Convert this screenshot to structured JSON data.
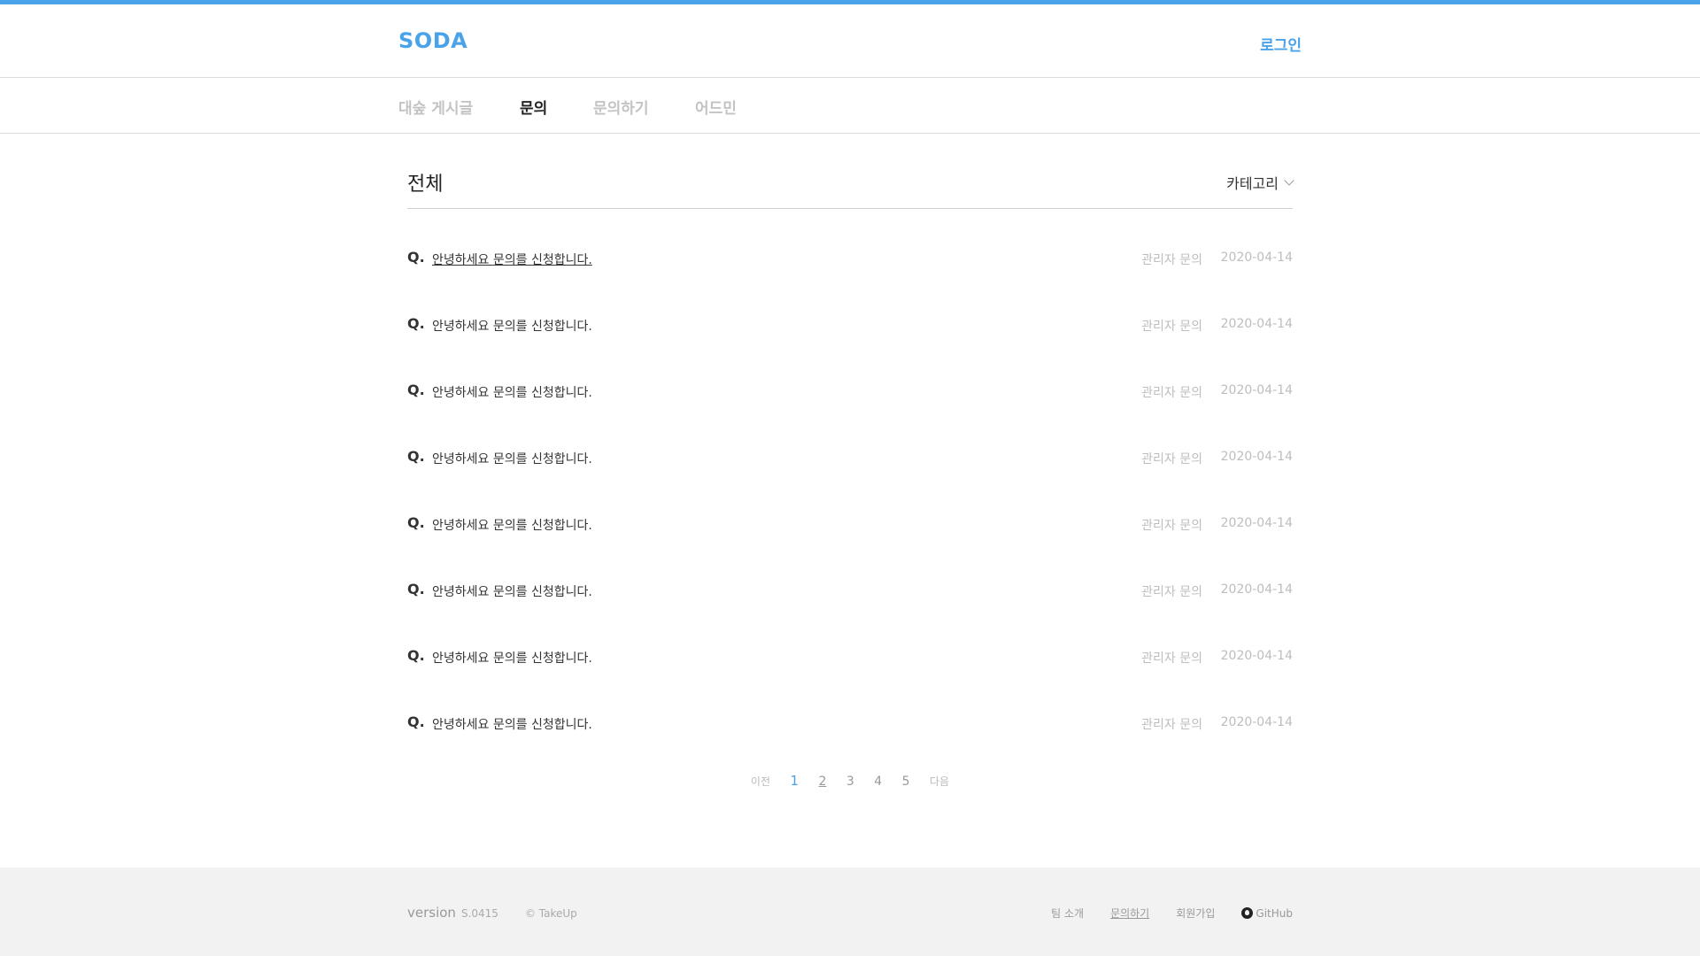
{
  "header": {
    "logo": "SODA",
    "login_label": "로그인"
  },
  "nav": {
    "items": [
      {
        "label": "대숲 게시글",
        "active": false
      },
      {
        "label": "문의",
        "active": true
      },
      {
        "label": "문의하기",
        "active": false
      },
      {
        "label": "어드민",
        "active": false
      }
    ]
  },
  "board": {
    "title": "전체",
    "category_label": "카테고리"
  },
  "list": {
    "q_mark": "Q.",
    "rows": [
      {
        "title": "안녕하세요 문의를 신청합니다.",
        "author": "관리자 문의",
        "date": "2020-04-14"
      },
      {
        "title": "안녕하세요 문의를 신청합니다.",
        "author": "관리자 문의",
        "date": "2020-04-14"
      },
      {
        "title": "안녕하세요 문의를 신청합니다.",
        "author": "관리자 문의",
        "date": "2020-04-14"
      },
      {
        "title": "안녕하세요 문의를 신청합니다.",
        "author": "관리자 문의",
        "date": "2020-04-14"
      },
      {
        "title": "안녕하세요 문의를 신청합니다.",
        "author": "관리자 문의",
        "date": "2020-04-14"
      },
      {
        "title": "안녕하세요 문의를 신청합니다.",
        "author": "관리자 문의",
        "date": "2020-04-14"
      },
      {
        "title": "안녕하세요 문의를 신청합니다.",
        "author": "관리자 문의",
        "date": "2020-04-14"
      },
      {
        "title": "안녕하세요 문의를 신청합니다.",
        "author": "관리자 문의",
        "date": "2020-04-14"
      }
    ]
  },
  "pagination": {
    "prev": "이전",
    "pages": [
      "1",
      "2",
      "3",
      "4",
      "5"
    ],
    "current": "1",
    "next": "다음"
  },
  "footer": {
    "version_label": "version",
    "version_number": "S.0415",
    "copyright": "© TakeUp",
    "links": [
      "팀 소개",
      "문의하기",
      "회원가입"
    ],
    "github_label": "GitHub"
  },
  "colors": {
    "accent": "#4aa3e8",
    "muted": "#bdbdbd",
    "footer_bg": "#f2f2f2"
  },
  "icons": [
    "chevron-down-icon",
    "github-icon"
  ]
}
